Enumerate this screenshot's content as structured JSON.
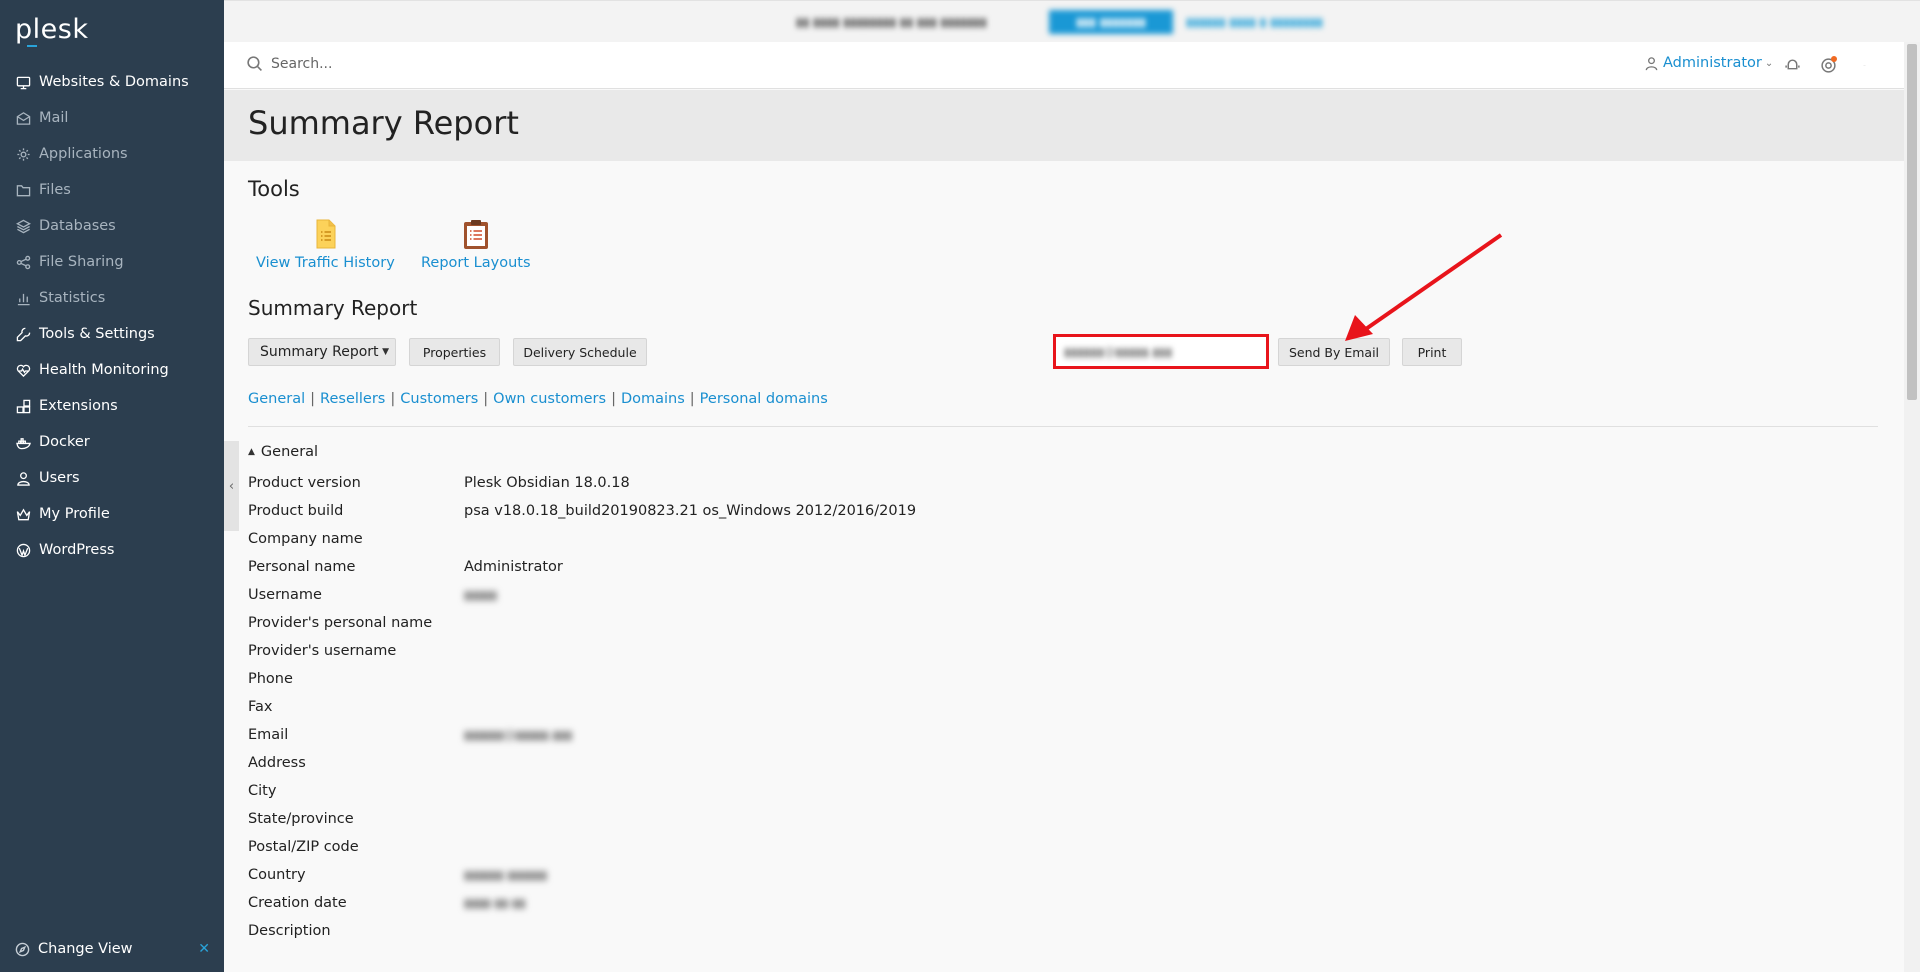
{
  "sidebar": {
    "logo": "plesk",
    "items": [
      {
        "label": "Websites & Domains",
        "icon": "monitor-icon",
        "bright": true
      },
      {
        "label": "Mail",
        "icon": "mail-icon",
        "bright": false
      },
      {
        "label": "Applications",
        "icon": "gear-icon",
        "bright": false
      },
      {
        "label": "Files",
        "icon": "folder-icon",
        "bright": false
      },
      {
        "label": "Databases",
        "icon": "layers-icon",
        "bright": false
      },
      {
        "label": "File Sharing",
        "icon": "share-icon",
        "bright": false
      },
      {
        "label": "Statistics",
        "icon": "bar-chart-icon",
        "bright": false
      },
      {
        "label": "Tools & Settings",
        "icon": "tools-icon",
        "bright": true
      },
      {
        "label": "Health Monitoring",
        "icon": "heart-pulse-icon",
        "bright": true
      },
      {
        "label": "Extensions",
        "icon": "blocks-icon",
        "bright": true
      },
      {
        "label": "Docker",
        "icon": "docker-icon",
        "bright": true
      },
      {
        "label": "Users",
        "icon": "user-icon",
        "bright": true
      },
      {
        "label": "My Profile",
        "icon": "crown-icon",
        "bright": true
      },
      {
        "label": "WordPress",
        "icon": "wordpress-icon",
        "bright": true
      }
    ],
    "change_view": "Change View"
  },
  "topbar": {
    "search_placeholder": "Search...",
    "user": "Administrator"
  },
  "page": {
    "title": "Summary Report"
  },
  "tools": {
    "heading": "Tools",
    "items": [
      {
        "label": "View Traffic History",
        "icon": "document-list-icon"
      },
      {
        "label": "Report Layouts",
        "icon": "clipboard-icon"
      }
    ]
  },
  "summary": {
    "heading": "Summary Report",
    "select_value": "Summary Report",
    "properties": "Properties",
    "delivery_schedule": "Delivery Schedule",
    "send_by_email": "Send By Email",
    "print": "Print"
  },
  "links": [
    "General",
    "Resellers",
    "Customers",
    "Own customers",
    "Domains",
    "Personal domains"
  ],
  "general": {
    "heading": "General",
    "rows": [
      {
        "key": "Product version",
        "value": "Plesk Obsidian 18.0.18"
      },
      {
        "key": "Product build",
        "value": "psa v18.0.18_build20190823.21 os_Windows 2012/2016/2019"
      },
      {
        "key": "Company name",
        "value": ""
      },
      {
        "key": "Personal name",
        "value": "Administrator"
      },
      {
        "key": "Username",
        "value": ""
      },
      {
        "key": "Provider's personal name",
        "value": ""
      },
      {
        "key": "Provider's username",
        "value": ""
      },
      {
        "key": "Phone",
        "value": ""
      },
      {
        "key": "Fax",
        "value": ""
      },
      {
        "key": "Email",
        "value": ""
      },
      {
        "key": "Address",
        "value": ""
      },
      {
        "key": "City",
        "value": ""
      },
      {
        "key": "State/province",
        "value": ""
      },
      {
        "key": "Postal/ZIP code",
        "value": ""
      },
      {
        "key": "Country",
        "value": ""
      },
      {
        "key": "Creation date",
        "value": ""
      },
      {
        "key": "Description",
        "value": ""
      }
    ]
  },
  "colors": {
    "sidebar_bg": "#2c3e4f",
    "link": "#1a8fd0",
    "annotation_red": "#e8141b"
  }
}
